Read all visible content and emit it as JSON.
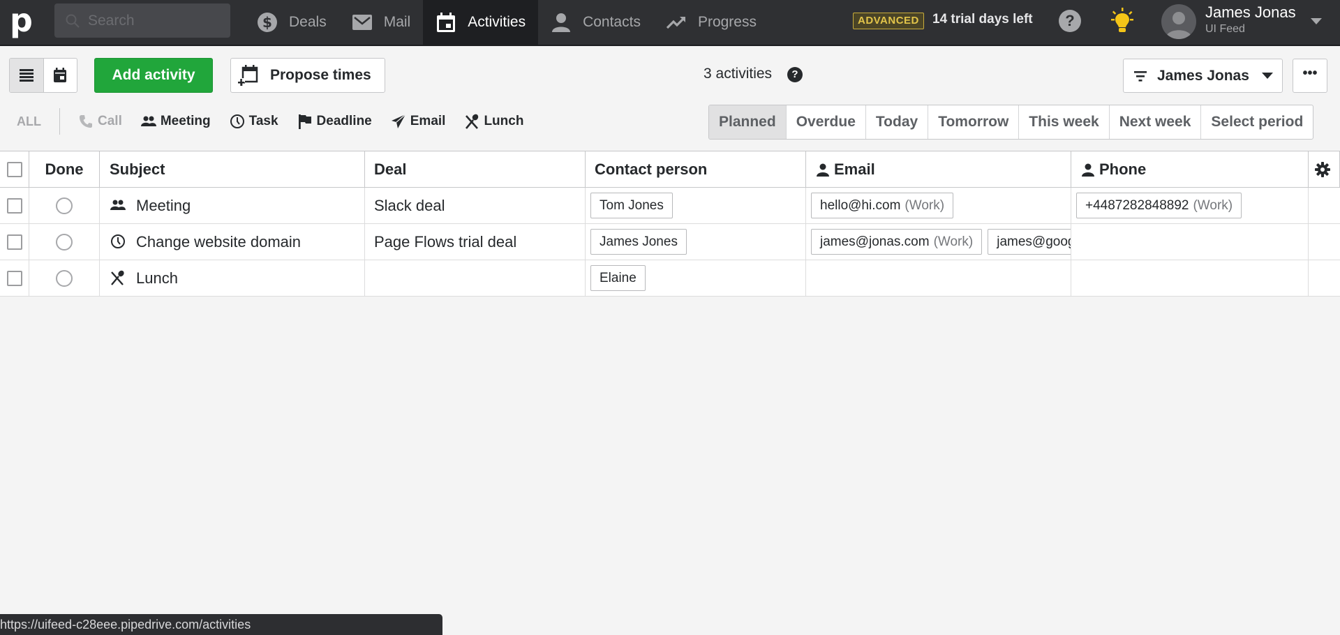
{
  "topbar": {
    "logo": "p",
    "search_placeholder": "Search",
    "nav": [
      {
        "label": "Deals",
        "icon": "dollar-icon",
        "active": false
      },
      {
        "label": "Mail",
        "icon": "mail-icon",
        "active": false
      },
      {
        "label": "Activities",
        "icon": "calendar-icon",
        "active": true
      },
      {
        "label": "Contacts",
        "icon": "person-icon",
        "active": false
      },
      {
        "label": "Progress",
        "icon": "trend-icon",
        "active": false
      }
    ],
    "plan_badge": "ADVANCED",
    "trial_text": "14 trial days left",
    "help_symbol": "?",
    "user": {
      "name": "James Jonas",
      "company": "UI Feed"
    }
  },
  "toolbar": {
    "add_label": "Add activity",
    "propose_label": "Propose times",
    "count_text": "3 activities",
    "count_help": "?",
    "owner_filter": "James Jonas",
    "more_label": "•••"
  },
  "type_filters": {
    "all_label": "ALL",
    "items": [
      {
        "label": "Call",
        "icon": "phone-icon",
        "muted": true
      },
      {
        "label": "Meeting",
        "icon": "people-icon",
        "muted": false
      },
      {
        "label": "Task",
        "icon": "clock-icon",
        "muted": false
      },
      {
        "label": "Deadline",
        "icon": "flag-icon",
        "muted": false
      },
      {
        "label": "Email",
        "icon": "paper-plane-icon",
        "muted": false
      },
      {
        "label": "Lunch",
        "icon": "utensils-icon",
        "muted": false
      }
    ]
  },
  "period_filters": {
    "selected": "Planned",
    "items": [
      "Planned",
      "Overdue",
      "Today",
      "Tomorrow",
      "This week",
      "Next week",
      "Select period"
    ]
  },
  "table": {
    "columns": [
      "Done",
      "Subject",
      "Deal",
      "Contact person",
      "Email",
      "Phone"
    ],
    "rows": [
      {
        "type_icon": "people-icon",
        "subject": "Meeting",
        "deal": "Slack deal",
        "contact": "Tom Jones",
        "emails": [
          {
            "value": "hello@hi.com",
            "label": "(Work)"
          }
        ],
        "phones": [
          {
            "value": "+4487282848892",
            "label": "(Work)"
          }
        ]
      },
      {
        "type_icon": "clock-icon",
        "subject": "Change website domain",
        "deal": "Page Flows trial deal",
        "contact": "James Jones",
        "emails": [
          {
            "value": "james@jonas.com",
            "label": "(Work)"
          },
          {
            "value": "james@goog",
            "label": ""
          }
        ],
        "phones": []
      },
      {
        "type_icon": "utensils-icon",
        "subject": "Lunch",
        "deal": "",
        "contact": "Elaine",
        "emails": [],
        "phones": []
      }
    ]
  },
  "status_bar": {
    "url": "https://uifeed-c28eee.pipedrive.com/activities"
  },
  "colors": {
    "topbar_bg": "#2f3033",
    "active_tab_bg": "#1e1f22",
    "primary_green": "#21a63b",
    "badge_gold": "#e2c44a",
    "bulb_yellow": "#f5c518",
    "page_bg": "#f4f4f4"
  }
}
